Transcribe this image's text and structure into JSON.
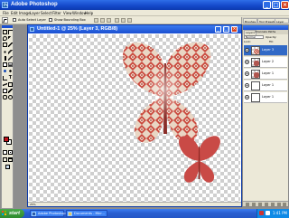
{
  "window": {
    "title": "Adobe Photoshop",
    "app_icon_label": "Ps",
    "buttons": {
      "minimize": "_",
      "maximize": "□",
      "close": "×"
    }
  },
  "menu": {
    "items": [
      "File",
      "Edit",
      "Image",
      "Layer",
      "Select",
      "Filter",
      "View",
      "Window",
      "Help"
    ]
  },
  "options": {
    "auto_select_layer": "Auto Select Layer",
    "show_bounding_box": "Show Bounding Box",
    "palette_well_tabs": [
      "Brushes",
      "Tool Presets",
      "Layer Comps"
    ]
  },
  "document": {
    "title": "Untitled-1 @ 25% (Layer 3, RGB/8)",
    "zoom": "25%",
    "buttons": {
      "minimize": "_",
      "maximize": "□",
      "close": "×"
    }
  },
  "layers_panel": {
    "tabs": [
      "Layers",
      "Channels",
      "Paths"
    ],
    "blend_mode": "Normal",
    "opacity_label": "Opacity:",
    "lock_label": "Lock:",
    "fill_label": "Fill:",
    "layers": [
      {
        "name": "Layer 3",
        "selected": true,
        "thumb": "butterfly-pattern"
      },
      {
        "name": "Layer 2",
        "selected": false,
        "thumb": "butterfly-red"
      },
      {
        "name": "Layer 1",
        "selected": false,
        "thumb": "butterfly-red"
      },
      {
        "name": "Layer 1",
        "selected": false,
        "thumb": "plain"
      },
      {
        "name": "Layer 1",
        "selected": false,
        "thumb": "plain"
      }
    ]
  },
  "taskbar": {
    "start_label": "start",
    "tasks": [
      {
        "label": "Adobe Photoshop",
        "active": false
      },
      {
        "label": "Documents - Micr...",
        "active": false
      }
    ],
    "clock": "1:41 PM"
  },
  "colors": {
    "foreground": "#c0101a",
    "background": "#ffffff",
    "butterfly_large": "#c9473c",
    "butterfly_small": "#c94a46"
  }
}
